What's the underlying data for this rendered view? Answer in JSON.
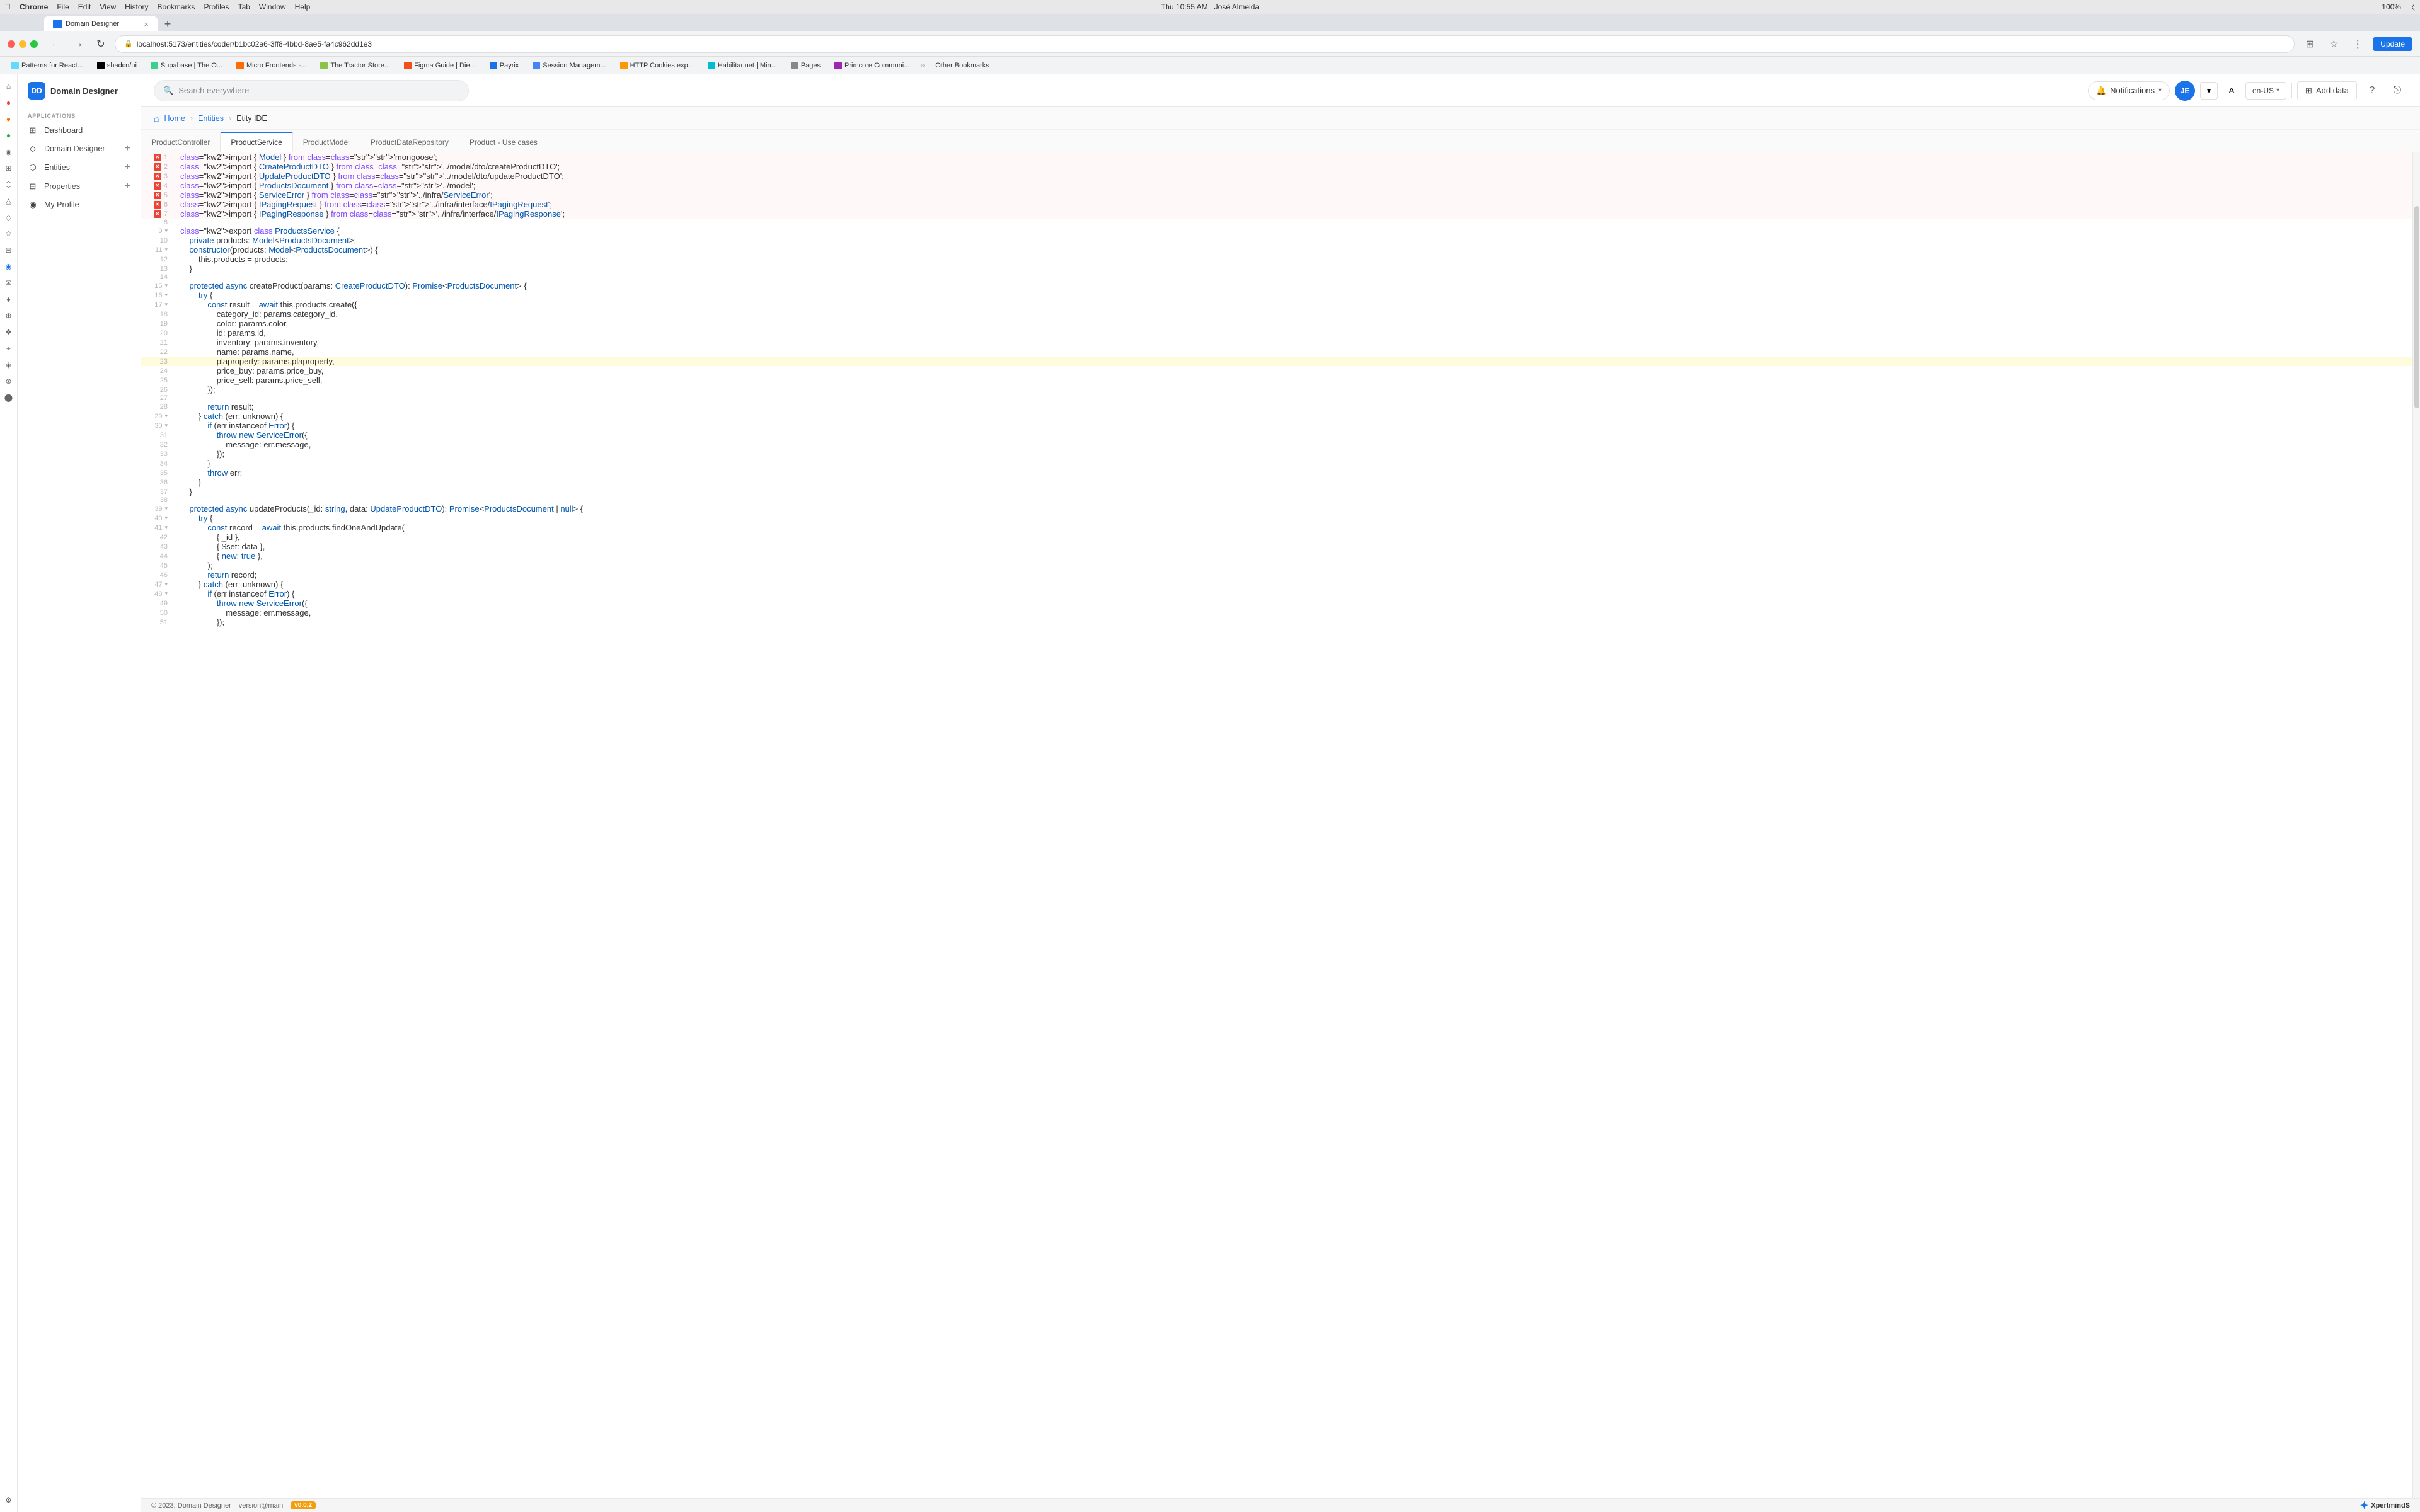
{
  "mac": {
    "top_left": [
      "Apple",
      "Chrome",
      "File",
      "Edit",
      "View",
      "History",
      "Bookmarks",
      "Profiles",
      "Tab",
      "Window",
      "Help"
    ],
    "top_right_items": [
      "zoom",
      "speaker",
      "keyboard",
      "wifi",
      "battery",
      "time",
      "user"
    ],
    "time": "Thu 10:55 AM",
    "user": "José Almeida",
    "battery": "100%"
  },
  "browser": {
    "tab_title": "Domain Designer",
    "tab_favicon_color": "#1a73e8",
    "address": "localhost:5173/entities/coder/b1bc02a6-3ff8-4bbd-8ae5-fa4c962dd1e3",
    "bookmarks": [
      {
        "label": "Patterns for React...",
        "color": "#61dafb"
      },
      {
        "label": "shadcn/ui",
        "color": "#000"
      },
      {
        "label": "Supabase | The O...",
        "color": "#3ecf8e"
      },
      {
        "label": "Micro Frontends -...",
        "color": "#ff6d00"
      },
      {
        "label": "The Tractor Store...",
        "color": "#8bc34a"
      },
      {
        "label": "Figma Guide | Die...",
        "color": "#f24e1e"
      },
      {
        "label": "Payrix",
        "color": "#1a73e8"
      },
      {
        "label": "Session Managem...",
        "color": "#4285f4"
      },
      {
        "label": "HTTP Cookies exp...",
        "color": "#ff9800"
      },
      {
        "label": "Habilitar.net | Min...",
        "color": "#00bcd4"
      },
      {
        "label": "Pages",
        "color": "#888"
      },
      {
        "label": "Primcore Communi...",
        "color": "#9c27b0"
      },
      {
        "label": "Other Bookmarks",
        "color": "#666"
      }
    ]
  },
  "sidebar": {
    "logo_text": "Domain Designer",
    "logo_abbr": "DD",
    "section_label": "APPLICATIONS",
    "items": [
      {
        "label": "Dashboard",
        "icon": "⊞",
        "active": false
      },
      {
        "label": "Domain Designer",
        "icon": "◇",
        "active": false,
        "has_plus": true
      },
      {
        "label": "Entities",
        "icon": "⬡",
        "active": false,
        "has_plus": true
      },
      {
        "label": "Properties",
        "icon": "⊟",
        "active": false,
        "has_plus": true
      },
      {
        "label": "My Profile",
        "icon": "◉",
        "active": false
      }
    ]
  },
  "header": {
    "search_placeholder": "Search everywhere",
    "notifications_label": "Notifications",
    "avatar_initials": "JE",
    "language": "en-US",
    "add_data_label": "Add data"
  },
  "breadcrumb": {
    "home": "Home",
    "entities": "Entities",
    "current": "Etity IDE"
  },
  "tabs": [
    {
      "label": "ProductController",
      "active": false
    },
    {
      "label": "ProductService",
      "active": true
    },
    {
      "label": "ProductModel",
      "active": false
    },
    {
      "label": "ProductDataRepository",
      "active": false
    },
    {
      "label": "Product - Use cases",
      "active": false
    }
  ],
  "code": {
    "lines": [
      {
        "num": 1,
        "error": true,
        "content": "import { Model } from 'mongoose';",
        "tokens": [
          {
            "t": "import",
            "c": "kw"
          },
          {
            "t": " { "
          },
          {
            "t": "Model",
            "c": "cls"
          },
          {
            "t": " } "
          },
          {
            "t": "from",
            "c": "kw"
          },
          {
            "t": " "
          },
          {
            "t": "'mongoose'",
            "c": "str"
          },
          {
            "t": ";"
          }
        ]
      },
      {
        "num": 2,
        "error": true,
        "content": "import { CreateProductDTO } from '../model/dto/createProductDTO';"
      },
      {
        "num": 3,
        "error": true,
        "content": "import { UpdateProductDTO } from '../model/dto/updateProductDTO';"
      },
      {
        "num": 4,
        "error": true,
        "content": "import { ProductsDocument } from '../model';"
      },
      {
        "num": 5,
        "error": true,
        "content": "import { ServiceError } from '../infra/ServiceError';"
      },
      {
        "num": 6,
        "error": true,
        "content": "import { IPagingRequest } from '../infra/interface/IPagingRequest';"
      },
      {
        "num": 7,
        "error": true,
        "content": "import { IPagingResponse } from '../infra/interface/IPagingResponse';"
      },
      {
        "num": 8,
        "error": false,
        "content": ""
      },
      {
        "num": 9,
        "error": false,
        "content": "export class ProductsService {",
        "fold": true
      },
      {
        "num": 10,
        "error": false,
        "content": "    private products: Model<ProductsDocument>;"
      },
      {
        "num": 11,
        "error": false,
        "content": "    constructor(products: Model<ProductsDocument>) {",
        "fold": true
      },
      {
        "num": 12,
        "error": false,
        "content": "        this.products = products;"
      },
      {
        "num": 13,
        "error": false,
        "content": "    }"
      },
      {
        "num": 14,
        "error": false,
        "content": ""
      },
      {
        "num": 15,
        "error": false,
        "content": "    protected async createProduct(params: CreateProductDTO): Promise<ProductsDocument> {",
        "fold": true
      },
      {
        "num": 16,
        "error": false,
        "content": "        try {",
        "fold": true
      },
      {
        "num": 17,
        "error": false,
        "content": "            const result = await this.products.create({",
        "fold": true
      },
      {
        "num": 18,
        "error": false,
        "content": "                category_id: params.category_id,"
      },
      {
        "num": 19,
        "error": false,
        "content": "                color: params.color,"
      },
      {
        "num": 20,
        "error": false,
        "content": "                id: params.id,"
      },
      {
        "num": 21,
        "error": false,
        "content": "                inventory: params.inventory,"
      },
      {
        "num": 22,
        "error": false,
        "content": "                name: params.name,"
      },
      {
        "num": 23,
        "error": false,
        "content": "                plaproperty: params.plaproperty,",
        "highlighted": true
      },
      {
        "num": 24,
        "error": false,
        "content": "                price_buy: params.price_buy,"
      },
      {
        "num": 25,
        "error": false,
        "content": "                price_sell: params.price_sell,"
      },
      {
        "num": 26,
        "error": false,
        "content": "            });"
      },
      {
        "num": 27,
        "error": false,
        "content": ""
      },
      {
        "num": 28,
        "error": false,
        "content": "            return result;"
      },
      {
        "num": 29,
        "error": false,
        "content": "        } catch (err: unknown) {",
        "fold": true
      },
      {
        "num": 30,
        "error": false,
        "content": "            if (err instanceof Error) {",
        "fold": true
      },
      {
        "num": 31,
        "error": false,
        "content": "                throw new ServiceError({"
      },
      {
        "num": 32,
        "error": false,
        "content": "                    message: err.message,"
      },
      {
        "num": 33,
        "error": false,
        "content": "                });"
      },
      {
        "num": 34,
        "error": false,
        "content": "            }"
      },
      {
        "num": 35,
        "error": false,
        "content": "            throw err;"
      },
      {
        "num": 36,
        "error": false,
        "content": "        }"
      },
      {
        "num": 37,
        "error": false,
        "content": "    }"
      },
      {
        "num": 38,
        "error": false,
        "content": ""
      },
      {
        "num": 39,
        "error": false,
        "content": "    protected async updateProducts(_id: string, data: UpdateProductDTO): Promise<ProductsDocument | null> {",
        "fold": true
      },
      {
        "num": 40,
        "error": false,
        "content": "        try {",
        "fold": true
      },
      {
        "num": 41,
        "error": false,
        "content": "            const record = await this.products.findOneAndUpdate(",
        "fold": true
      },
      {
        "num": 42,
        "error": false,
        "content": "                { _id },"
      },
      {
        "num": 43,
        "error": false,
        "content": "                { $set: data },"
      },
      {
        "num": 44,
        "error": false,
        "content": "                { new: true },"
      },
      {
        "num": 45,
        "error": false,
        "content": "            );"
      },
      {
        "num": 46,
        "error": false,
        "content": "            return record;"
      },
      {
        "num": 47,
        "error": false,
        "content": "        } catch (err: unknown) {",
        "fold": true
      },
      {
        "num": 48,
        "error": false,
        "content": "            if (err instanceof Error) {",
        "fold": true
      },
      {
        "num": 49,
        "error": false,
        "content": "                throw new ServiceError({"
      },
      {
        "num": 50,
        "error": false,
        "content": "                    message: err.message,"
      },
      {
        "num": 51,
        "error": false,
        "content": "                });"
      }
    ]
  },
  "footer": {
    "copyright": "© 2023, Domain Designer",
    "version": "version@main",
    "version_badge": "v0.0.2",
    "logo_text": "XpertmindS"
  }
}
